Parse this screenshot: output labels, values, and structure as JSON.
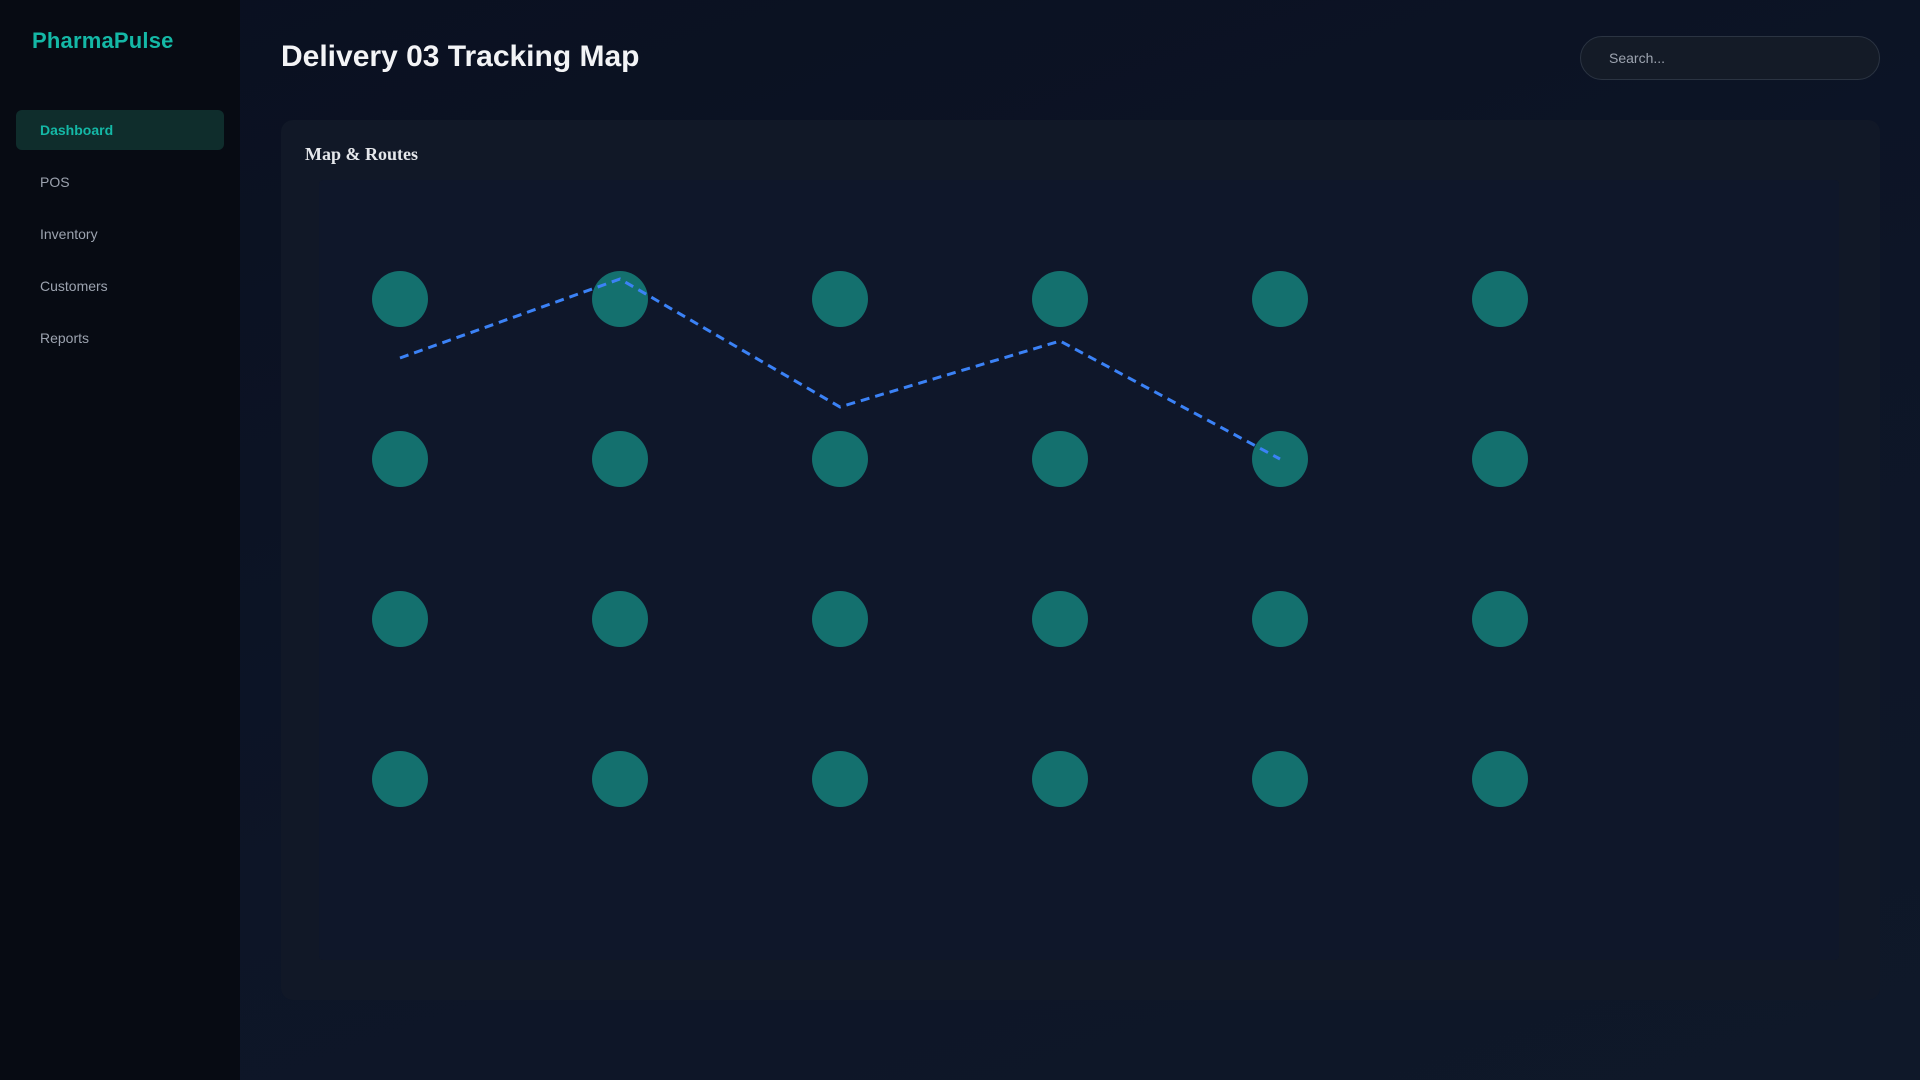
{
  "app": {
    "brand": "PharmaPulse"
  },
  "sidebar": {
    "items": [
      {
        "label": "Dashboard",
        "active": true
      },
      {
        "label": "POS",
        "active": false
      },
      {
        "label": "Inventory",
        "active": false
      },
      {
        "label": "Customers",
        "active": false
      },
      {
        "label": "Reports",
        "active": false
      }
    ]
  },
  "header": {
    "title": "Delivery 03 Tracking Map",
    "search_placeholder": "Search..."
  },
  "map": {
    "card_title": "Map & Routes",
    "grid_rows": 4,
    "grid_cols": 6,
    "node_color": "#14706e",
    "route_color": "#3b82f6"
  },
  "colors": {
    "accent": "#14b8a6",
    "background": "#0b1120",
    "sidebar": "#070b13",
    "card": "#111827"
  }
}
